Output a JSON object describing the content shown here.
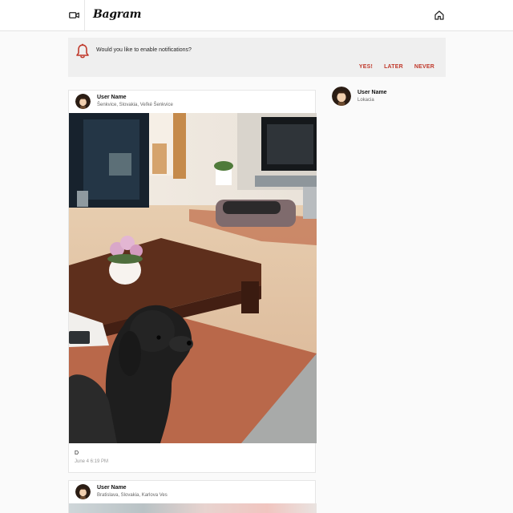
{
  "app": {
    "logo": "Bagram"
  },
  "icons": {
    "camera": "video-camera-icon",
    "home": "home-icon",
    "bell": "bell-icon"
  },
  "colors": {
    "accent": "#c0392b"
  },
  "notification": {
    "message": "Would you like to enable notifications?",
    "yes": "YES!",
    "later": "LATER",
    "never": "NEVER"
  },
  "posts": [
    {
      "user": "User Name",
      "location": "Šenkvice, Slovakia, Veľké Šenkvice",
      "caption": "D",
      "timestamp": "June 4 6:19 PM"
    },
    {
      "user": "User Name",
      "location": "Bratislava, Slovakia, Karlova Ves"
    }
  ],
  "sidebar": {
    "user": "User Name",
    "location": "Lokacia"
  }
}
